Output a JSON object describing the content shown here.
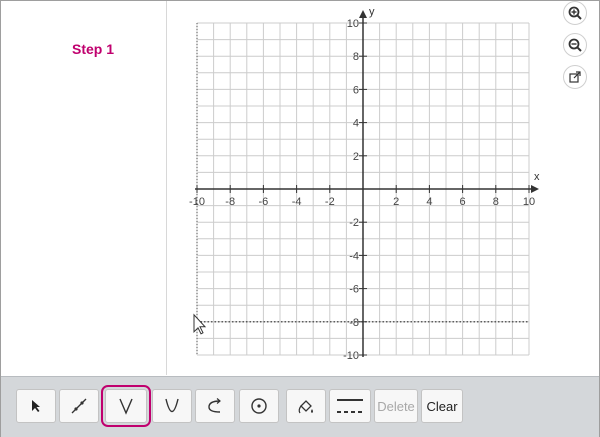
{
  "step": {
    "label": "Step 1"
  },
  "graph": {
    "x_label": "x",
    "y_label": "y",
    "x_ticks": [
      "-10",
      "-8",
      "-6",
      "-4",
      "-2",
      "2",
      "4",
      "6",
      "8",
      "10"
    ],
    "y_ticks": [
      "10",
      "8",
      "6",
      "4",
      "2",
      "-2",
      "-4",
      "-6",
      "-8",
      "-10"
    ],
    "x_range": [
      -10,
      10
    ],
    "y_range": [
      -10,
      10
    ],
    "dotted_line_y": -8
  },
  "zoom": {
    "zoom_in_icon": "zoom-in-icon",
    "zoom_out_icon": "zoom-out-icon",
    "popout_icon": "popout-icon"
  },
  "toolbar": {
    "tools": [
      {
        "name": "select-tool",
        "icon": "arrow-pointer-icon"
      },
      {
        "name": "line-tool",
        "icon": "line-icon"
      },
      {
        "name": "absolute-value-tool",
        "icon": "v-shape-icon",
        "selected": true
      },
      {
        "name": "parabola-tool",
        "icon": "parabola-icon"
      },
      {
        "name": "exponential-tool",
        "icon": "curve-arrow-icon"
      },
      {
        "name": "circle-tool",
        "icon": "circle-dot-icon"
      },
      {
        "name": "fill-tool",
        "icon": "fill-icon"
      },
      {
        "name": "line-style-tool",
        "icon": "line-style-icon"
      }
    ],
    "delete_label": "Delete",
    "clear_label": "Clear"
  },
  "colors": {
    "accent": "#c0006e",
    "grid": "#cccccc",
    "axis": "#333333"
  }
}
